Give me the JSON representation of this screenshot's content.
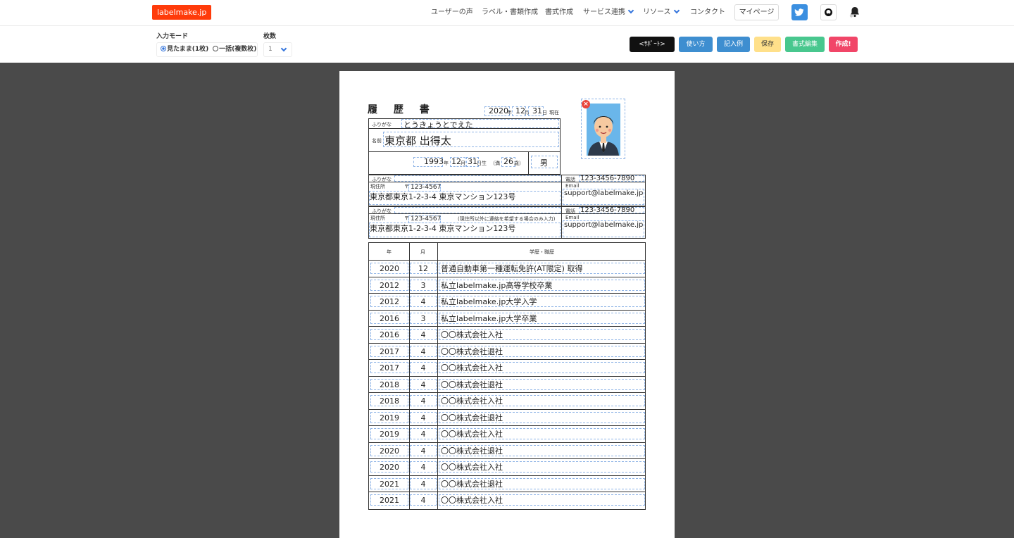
{
  "nav": {
    "logo": "labelmake.jp",
    "items": [
      {
        "label": "ユーザーの声"
      },
      {
        "label": "ラベル・書類作成"
      },
      {
        "label": "書式作成"
      },
      {
        "label": "サービス連携"
      },
      {
        "label": "リソース"
      },
      {
        "label": "コンタクト"
      }
    ],
    "mypage": "マイページ"
  },
  "toolbar": {
    "mode_label": "入力モード",
    "mode_option_1": "見たまま(1枚)",
    "mode_option_2": "一括(複数枚)",
    "count_label": "枚数",
    "count_value": "1",
    "support_label": "<ｻﾎﾟｰﾄ>",
    "buttons": [
      {
        "label": "使い方",
        "color": "#3e8ed0"
      },
      {
        "label": "記入例",
        "color": "#3e8ed0"
      },
      {
        "label": "保存",
        "color": "#ffe08a"
      },
      {
        "label": "書式編集",
        "color": "#48c78e"
      },
      {
        "label": "作成!",
        "color": "#f14668"
      }
    ]
  },
  "resume": {
    "title": "履 歴 書",
    "date": {
      "year": "2020",
      "year_unit": "年",
      "month": "12",
      "month_unit": "月",
      "day": "31",
      "day_unit": "日",
      "suffix": "現在"
    },
    "furigana_label": "ふりがな",
    "furigana": "とうきょうとでえた",
    "name_label": "名前",
    "name": "東京都 出得太",
    "birth": {
      "year": "1993",
      "year_unit": "年",
      "month": "12",
      "month_unit": "月",
      "day": "31",
      "day_unit": "日生",
      "age_prefix": "（満",
      "age": "26",
      "age_unit": "歳）"
    },
    "gender": "男",
    "address1": {
      "furigana_label": "ふりがな",
      "label": "現住所",
      "postal_mark": "〒",
      "postal": "123-4567",
      "address": "東京都東京1-2-3-4 東京マンション123号",
      "phone_label": "電話",
      "phone": "123-3456-7890",
      "email_label": "Email",
      "email": "support@labelmake.jp"
    },
    "address2": {
      "furigana_label": "ふりがな",
      "label": "現住所",
      "postal_mark": "〒",
      "postal": "123-4567",
      "note": "(現住所以外に連絡を希望する場合のみ入力)",
      "address": "東京都東京1-2-3-4 東京マンション123号",
      "phone_label": "電話",
      "phone": "123-3456-7890",
      "email_label": "Email",
      "email": "support@labelmake.jp"
    },
    "history_headers": {
      "year": "年",
      "month": "月",
      "text": "学歴・職歴"
    },
    "history": [
      {
        "year": "2020",
        "month": "12",
        "text": "普通自動車第一種運転免許(AT限定) 取得"
      },
      {
        "year": "2012",
        "month": "3",
        "text": "私立labelmake.jp高等学校卒業"
      },
      {
        "year": "2012",
        "month": "4",
        "text": "私立labelmake.jp大学入学"
      },
      {
        "year": "2016",
        "month": "3",
        "text": "私立labelmake.jp大学卒業"
      },
      {
        "year": "2016",
        "month": "4",
        "text": "〇〇株式会社入社"
      },
      {
        "year": "2017",
        "month": "4",
        "text": "〇〇株式会社退社"
      },
      {
        "year": "2017",
        "month": "4",
        "text": "〇〇株式会社入社"
      },
      {
        "year": "2018",
        "month": "4",
        "text": "〇〇株式会社退社"
      },
      {
        "year": "2018",
        "month": "4",
        "text": "〇〇株式会社入社"
      },
      {
        "year": "2019",
        "month": "4",
        "text": "〇〇株式会社退社"
      },
      {
        "year": "2019",
        "month": "4",
        "text": "〇〇株式会社入社"
      },
      {
        "year": "2020",
        "month": "4",
        "text": "〇〇株式会社退社"
      },
      {
        "year": "2020",
        "month": "4",
        "text": "〇〇株式会社入社"
      },
      {
        "year": "2021",
        "month": "4",
        "text": "〇〇株式会社退社"
      },
      {
        "year": "2021",
        "month": "4",
        "text": "〇〇株式会社入社"
      }
    ]
  }
}
